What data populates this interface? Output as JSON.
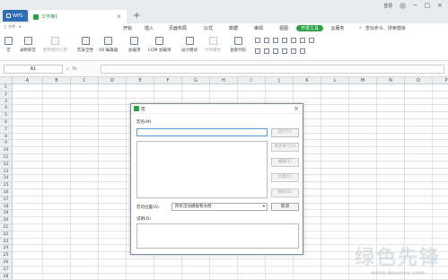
{
  "titlebar": {
    "app_tab": "WPS",
    "doc_tab": "工作簿1",
    "user_label": "登录"
  },
  "menubar": {
    "left_items": [
      "三 文件",
      "▾"
    ],
    "items": [
      "开始",
      "插入",
      "页面布局",
      "公式",
      "数据",
      "审阅",
      "视图",
      "开发工具",
      "云服务"
    ],
    "active_index": 7,
    "right_text": "查找命令、搜索模板"
  },
  "ribbon": {
    "buttons": [
      {
        "label": "宏",
        "disabled": false
      },
      {
        "label": "录制新宏",
        "disabled": false
      },
      {
        "label": "使用相对引用",
        "disabled": true
      },
      {
        "label": "宏安全性",
        "disabled": false
      },
      {
        "label": "VB 编辑器",
        "disabled": false
      },
      {
        "label": "加载项",
        "disabled": false
      },
      {
        "label": "COM 加载项",
        "disabled": false
      },
      {
        "label": "设计模式",
        "disabled": false
      },
      {
        "label": "控件属性",
        "disabled": true
      },
      {
        "label": "查看代码",
        "disabled": false
      }
    ]
  },
  "formula_bar": {
    "name_box": "A1",
    "fx": "fx"
  },
  "sheet": {
    "columns": [
      "A",
      "B",
      "C",
      "D",
      "E",
      "F",
      "G",
      "H",
      "I",
      "J",
      "K",
      "L",
      "M",
      "N",
      "O",
      "P",
      "Q"
    ],
    "rows": [
      "1",
      "2",
      "3",
      "4",
      "5",
      "6",
      "7",
      "8",
      "9",
      "10",
      "11",
      "12",
      "13",
      "14",
      "15",
      "16",
      "17",
      "18",
      "19",
      "20",
      "21",
      "22",
      "23",
      "24",
      "25",
      "26",
      "27",
      "28"
    ]
  },
  "dialog": {
    "title": "宏",
    "macro_name_label": "宏名(M):",
    "buttons": [
      "运行(R)",
      "单步执行(S)",
      "编辑(E)",
      "创建(C)",
      "删除(D)"
    ],
    "location_label": "宏的位置(A):",
    "location_value": "所有活动模板和文档",
    "cancel": "取消",
    "description_label": "说明(D)"
  },
  "watermark": {
    "main": "绿色先锋",
    "sub": "www.downcc.com"
  }
}
